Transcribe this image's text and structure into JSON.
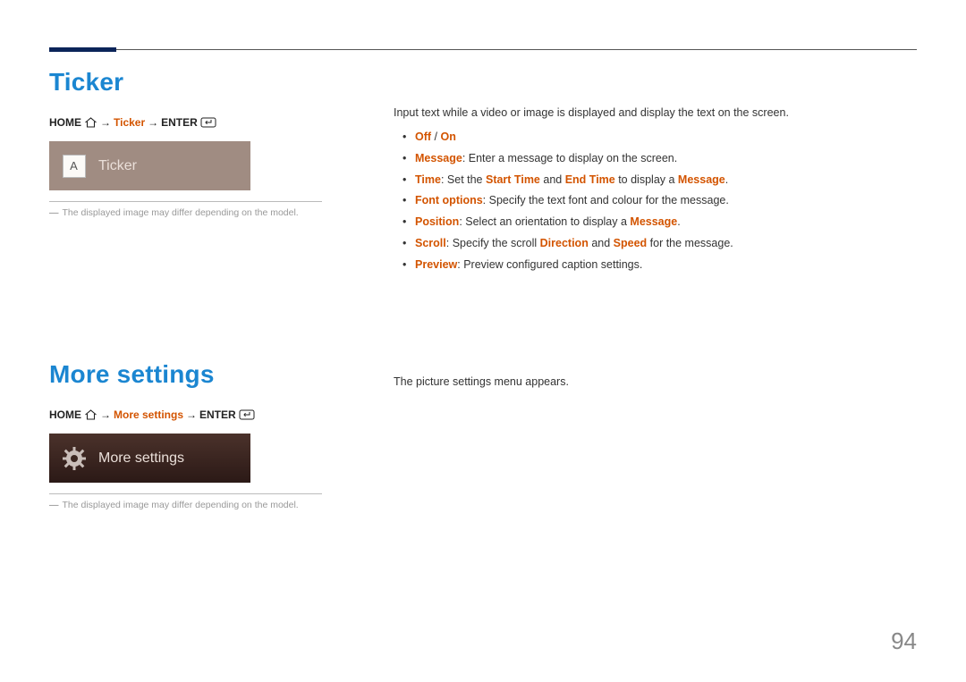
{
  "page_number": "94",
  "ticker": {
    "title": "Ticker",
    "breadcrumb": {
      "home": "HOME",
      "arrow": "→",
      "ticker": "Ticker",
      "enter": "ENTER"
    },
    "card_icon_letter": "A",
    "card_label": "Ticker",
    "footnote": "The displayed image may differ depending on the model.",
    "intro": "Input text while a video or image is displayed and display the text on the screen.",
    "items": {
      "offon": {
        "off": "Off",
        "slash": " / ",
        "on": "On"
      },
      "message": {
        "name": "Message",
        "rest": ": Enter a message to display on the screen."
      },
      "time": {
        "name": "Time",
        "pre": ": Set the ",
        "start": "Start Time",
        "mid": " and ",
        "end": "End Time",
        "post": " to display a ",
        "msg": "Message",
        "tail": "."
      },
      "font": {
        "name": "Font options",
        "rest": ": Specify the text font and colour for the message."
      },
      "position": {
        "name": "Position",
        "pre": ": Select an orientation to display a ",
        "msg": "Message",
        "tail": "."
      },
      "scroll": {
        "name": "Scroll",
        "pre": ": Specify the scroll ",
        "dir": "Direction",
        "mid": " and ",
        "spd": "Speed",
        "post": " for the message."
      },
      "preview": {
        "name": "Preview",
        "rest": ": Preview configured caption settings."
      }
    }
  },
  "more": {
    "title": "More settings",
    "breadcrumb": {
      "home": "HOME",
      "arrow": "→",
      "more": "More settings",
      "enter": "ENTER"
    },
    "card_label": "More settings",
    "footnote": "The displayed image may differ depending on the model.",
    "intro": "The picture settings menu appears."
  }
}
